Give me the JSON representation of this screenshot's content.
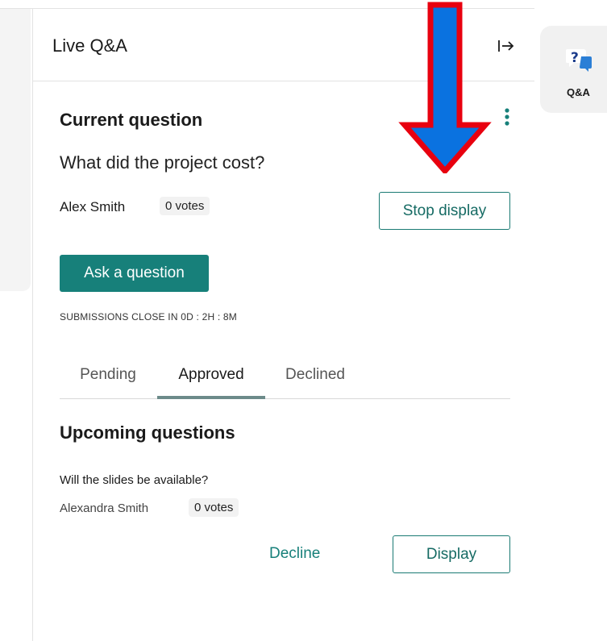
{
  "panel": {
    "title": "Live Q&A",
    "collapse_icon": "collapse-right-icon"
  },
  "current": {
    "heading": "Current question",
    "menu_icon": "kebab-menu-icon",
    "question": "What did the project cost?",
    "author": "Alex Smith",
    "votes": "0 votes",
    "stop_label": "Stop display"
  },
  "ask": {
    "label": "Ask a question",
    "submissions": "SUBMISSIONS CLOSE IN 0D : 2H : 8M"
  },
  "tabs": [
    {
      "label": "Pending",
      "active": false
    },
    {
      "label": "Approved",
      "active": true
    },
    {
      "label": "Declined",
      "active": false
    }
  ],
  "upcoming": {
    "heading": "Upcoming questions",
    "items": [
      {
        "question": "Will the slides be available?",
        "author": "Alexandra Smith",
        "votes": "0 votes",
        "decline_label": "Decline",
        "display_label": "Display"
      }
    ]
  },
  "rail": {
    "qa_label": "Q&A",
    "qa_icon": "qa-chat-icon"
  },
  "annotation": {
    "arrow_icon": "down-arrow-annotation-icon",
    "colors": {
      "fill": "#0a72e0",
      "stroke": "#e8000f"
    }
  },
  "colors": {
    "accent": "#17807a",
    "accent_text": "#166b64",
    "border": "#e3e3e3"
  }
}
